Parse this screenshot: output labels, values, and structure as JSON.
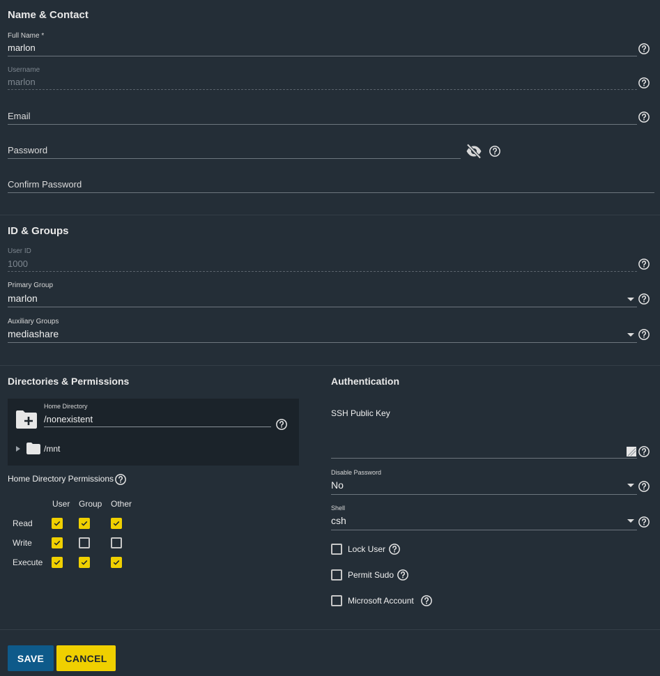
{
  "name_contact": {
    "title": "Name & Contact",
    "full_name": {
      "label": "Full Name *",
      "value": "marlon"
    },
    "username": {
      "label": "Username",
      "value": "marlon"
    },
    "email": {
      "label": "Email"
    },
    "password": {
      "label": "Password"
    },
    "confirm_password": {
      "label": "Confirm Password"
    }
  },
  "id_groups": {
    "title": "ID & Groups",
    "user_id": {
      "label": "User ID",
      "value": "1000"
    },
    "primary_group": {
      "label": "Primary Group",
      "value": "marlon"
    },
    "auxiliary_groups": {
      "label": "Auxiliary Groups",
      "value": "mediashare"
    }
  },
  "directories": {
    "title": "Directories & Permissions",
    "home_directory": {
      "label": "Home Directory",
      "value": "/nonexistent"
    },
    "tree_item": "/mnt",
    "permissions_title": "Home Directory Permissions",
    "columns": [
      "User",
      "Group",
      "Other"
    ],
    "rows": [
      {
        "label": "Read",
        "values": [
          true,
          true,
          true
        ]
      },
      {
        "label": "Write",
        "values": [
          true,
          false,
          false
        ]
      },
      {
        "label": "Execute",
        "values": [
          true,
          true,
          true
        ]
      }
    ]
  },
  "authentication": {
    "title": "Authentication",
    "ssh_key": {
      "label": "SSH Public Key"
    },
    "disable_password": {
      "label": "Disable Password",
      "value": "No"
    },
    "shell": {
      "label": "Shell",
      "value": "csh"
    },
    "checkboxes": [
      {
        "label": "Lock User",
        "checked": false
      },
      {
        "label": "Permit Sudo",
        "checked": false
      },
      {
        "label": "Microsoft Account",
        "checked": false
      }
    ]
  },
  "actions": {
    "save": "SAVE",
    "cancel": "CANCEL"
  },
  "colors": {
    "primary": "#0e5a8a",
    "accent": "#f0d000",
    "background": "#242e37"
  }
}
